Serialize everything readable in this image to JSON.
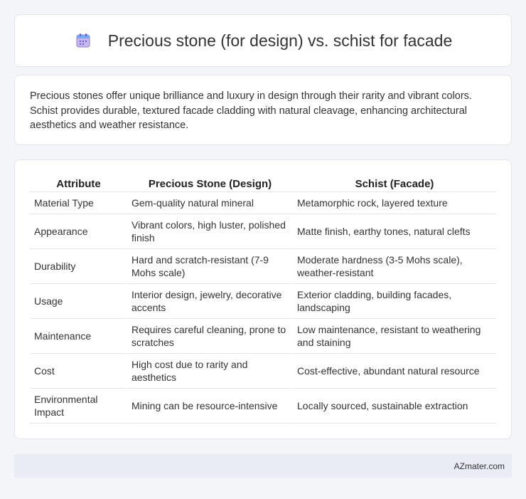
{
  "header": {
    "title": "Precious stone (for design) vs. schist for facade",
    "icon": "calendar-icon"
  },
  "intro": {
    "text": "Precious stones offer unique brilliance and luxury in design through their rarity and vibrant colors. Schist provides durable, textured facade cladding with natural cleavage, enhancing architectural aesthetics and weather resistance."
  },
  "table": {
    "headers": [
      "Attribute",
      "Precious Stone (Design)",
      "Schist (Facade)"
    ],
    "rows": [
      [
        "Material Type",
        "Gem-quality natural mineral",
        "Metamorphic rock, layered texture"
      ],
      [
        "Appearance",
        "Vibrant colors, high luster, polished finish",
        "Matte finish, earthy tones, natural clefts"
      ],
      [
        "Durability",
        "Hard and scratch-resistant (7-9 Mohs scale)",
        "Moderate hardness (3-5 Mohs scale), weather-resistant"
      ],
      [
        "Usage",
        "Interior design, jewelry, decorative accents",
        "Exterior cladding, building facades, landscaping"
      ],
      [
        "Maintenance",
        "Requires careful cleaning, prone to scratches",
        "Low maintenance, resistant to weathering and staining"
      ],
      [
        "Cost",
        "High cost due to rarity and aesthetics",
        "Cost-effective, abundant natural resource"
      ],
      [
        "Environmental Impact",
        "Mining can be resource-intensive",
        "Locally sourced, sustainable extraction"
      ]
    ]
  },
  "footer": {
    "text": "AZmater.com"
  }
}
